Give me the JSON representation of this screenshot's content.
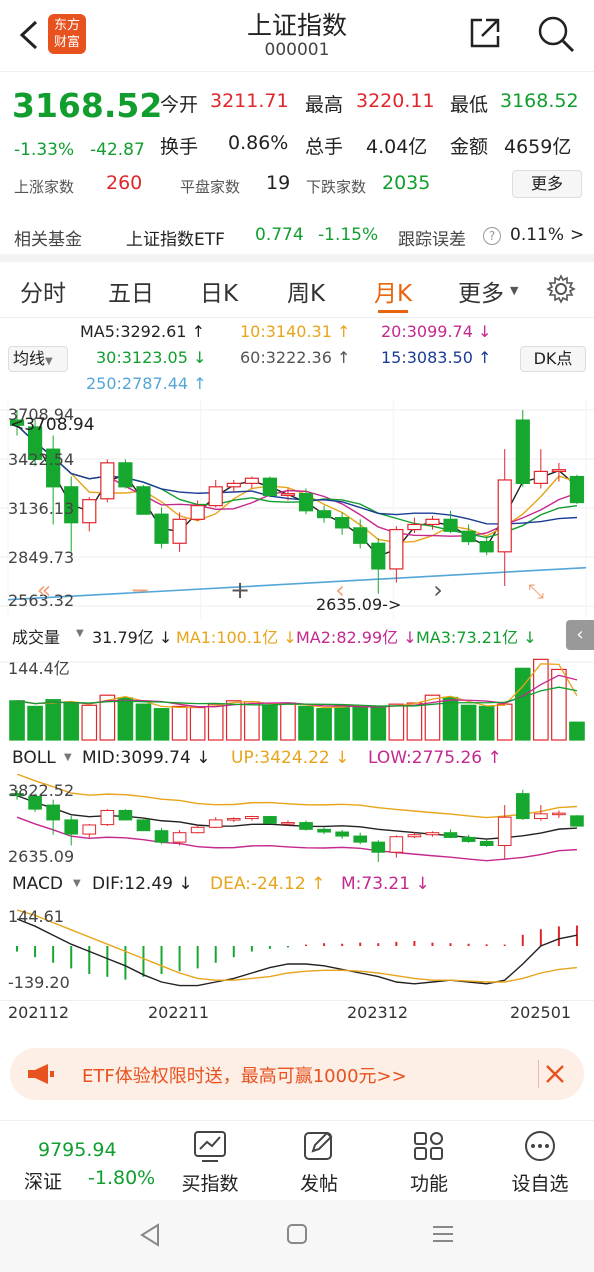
{
  "header": {
    "title": "上证指数",
    "code": "000001",
    "logo_text": "东方财富"
  },
  "quote": {
    "price": "3168.52",
    "change_pct": "-1.33%",
    "change": "-42.87",
    "open_label": "今开",
    "open": "3211.71",
    "high_label": "最高",
    "high": "3220.11",
    "low_label": "最低",
    "low": "3168.52",
    "turnover_label": "换手",
    "turnover": "0.86%",
    "volume_label": "总手",
    "volume": "4.04亿",
    "amount_label": "金额",
    "amount": "4659亿",
    "up_label": "上涨家数",
    "up_count": "260",
    "flat_label": "平盘家数",
    "flat_count": "19",
    "down_label": "下跌家数",
    "down_count": "2035",
    "more_label": "更多"
  },
  "fund": {
    "label": "相关基金",
    "name": "上证指数ETF",
    "price": "0.774",
    "change": "-1.15%",
    "tracking_label": "跟踪误差",
    "tracking_value": "0.11%",
    "arrow": ">"
  },
  "tabs": [
    "分时",
    "五日",
    "日K",
    "周K",
    "月K",
    "更多"
  ],
  "ma_panel": {
    "selector": "均线",
    "dk": "DK点",
    "ma5": "MA5:3292.61 ↑",
    "ma10": "10:3140.31 ↑",
    "ma20": "20:3099.74 ↓",
    "ma30": "30:3123.05 ↓",
    "ma60": "60:3222.36 ↑",
    "ma15": "15:3083.50 ↑",
    "ma250": "250:2787.44 ↑"
  },
  "chart_data": [
    {
      "type": "candlestick",
      "title": "月K",
      "y_ticks": [
        "3708.94",
        "3422.54",
        "3136.13",
        "2849.73",
        "2563.32"
      ],
      "ylim": [
        2563.32,
        3708.94
      ],
      "max_label": "3708.94",
      "min_label": "2635.09->",
      "x_labels": [
        "202112",
        "202211",
        "202312",
        "202501"
      ],
      "candles": [
        {
          "o": 3650,
          "h": 3708,
          "l": 3560,
          "c": 3620
        },
        {
          "o": 3610,
          "h": 3650,
          "l": 3380,
          "c": 3420
        },
        {
          "o": 3480,
          "h": 3560,
          "l": 3040,
          "c": 3260
        },
        {
          "o": 3260,
          "h": 3320,
          "l": 2880,
          "c": 3050
        },
        {
          "o": 3050,
          "h": 3200,
          "l": 3000,
          "c": 3185
        },
        {
          "o": 3190,
          "h": 3420,
          "l": 3170,
          "c": 3400
        },
        {
          "o": 3400,
          "h": 3420,
          "l": 3250,
          "c": 3260
        },
        {
          "o": 3260,
          "h": 3270,
          "l": 3100,
          "c": 3100
        },
        {
          "o": 3100,
          "h": 3140,
          "l": 2900,
          "c": 2930
        },
        {
          "o": 2930,
          "h": 3110,
          "l": 2880,
          "c": 3070
        },
        {
          "o": 3070,
          "h": 3180,
          "l": 3060,
          "c": 3150
        },
        {
          "o": 3150,
          "h": 3300,
          "l": 3140,
          "c": 3260
        },
        {
          "o": 3260,
          "h": 3300,
          "l": 3230,
          "c": 3280
        },
        {
          "o": 3280,
          "h": 3320,
          "l": 3250,
          "c": 3310
        },
        {
          "o": 3310,
          "h": 3320,
          "l": 3200,
          "c": 3210
        },
        {
          "o": 3210,
          "h": 3250,
          "l": 3180,
          "c": 3220
        },
        {
          "o": 3220,
          "h": 3250,
          "l": 3100,
          "c": 3120
        },
        {
          "o": 3120,
          "h": 3150,
          "l": 3050,
          "c": 3080
        },
        {
          "o": 3080,
          "h": 3110,
          "l": 2980,
          "c": 3020
        },
        {
          "o": 3020,
          "h": 3070,
          "l": 2900,
          "c": 2930
        },
        {
          "o": 2930,
          "h": 2960,
          "l": 2635,
          "c": 2780
        },
        {
          "o": 2780,
          "h": 3030,
          "l": 2700,
          "c": 3010
        },
        {
          "o": 3010,
          "h": 3080,
          "l": 2990,
          "c": 3040
        },
        {
          "o": 3040,
          "h": 3090,
          "l": 3010,
          "c": 3070
        },
        {
          "o": 3070,
          "h": 3120,
          "l": 2990,
          "c": 3000
        },
        {
          "o": 3000,
          "h": 3040,
          "l": 2920,
          "c": 2940
        },
        {
          "o": 2940,
          "h": 2970,
          "l": 2860,
          "c": 2880
        },
        {
          "o": 2880,
          "h": 3480,
          "l": 2680,
          "c": 3300
        },
        {
          "o": 3650,
          "h": 3708,
          "l": 3260,
          "c": 3280
        },
        {
          "o": 3280,
          "h": 3480,
          "l": 3250,
          "c": 3350
        },
        {
          "o": 3350,
          "h": 3400,
          "l": 3290,
          "c": 3360
        },
        {
          "o": 3320,
          "h": 3330,
          "l": 3160,
          "c": 3168
        }
      ],
      "ma250_start": 2600,
      "ma250_end": 2787.44
    },
    {
      "type": "bar",
      "title": "成交量",
      "y_tick": "144.4亿",
      "legend": [
        "成交量",
        "31.79亿 ↓",
        "MA1:100.1亿 ↓",
        "MA2:82.99亿 ↓",
        "MA3:73.21亿 ↓"
      ],
      "values": [
        70,
        60,
        72,
        66,
        62,
        80,
        75,
        64,
        56,
        60,
        58,
        64,
        70,
        68,
        62,
        66,
        60,
        56,
        62,
        60,
        58,
        64,
        66,
        80,
        76,
        62,
        60,
        64,
        128,
        144,
        126,
        31.79
      ]
    },
    {
      "type": "line",
      "title": "BOLL",
      "legend": [
        "BOLL",
        "MID:3099.74 ↓",
        "UP:3424.22 ↓",
        "LOW:2775.26 ↑"
      ],
      "y_ticks": [
        "3822.52",
        "2635.09"
      ]
    },
    {
      "type": "bar",
      "title": "MACD",
      "legend": [
        "MACD",
        "DIF:12.49 ↓",
        "DEA:-24.12 ↑",
        "M:73.21 ↓"
      ],
      "y_ticks": [
        "144.61",
        "-139.20"
      ],
      "values": [
        -20,
        -40,
        -60,
        -80,
        -100,
        -110,
        -120,
        -110,
        -100,
        -90,
        -80,
        -60,
        -40,
        -20,
        -10,
        -5,
        5,
        10,
        8,
        12,
        10,
        15,
        18,
        12,
        10,
        8,
        6,
        5,
        40,
        60,
        70,
        73
      ]
    }
  ],
  "banner": {
    "text": "ETF体验权限时送，最高可赢1000元>>"
  },
  "bottom": {
    "index_value": "9795.94",
    "index_name": "深证",
    "index_change": "-1.80%",
    "buy": "买指数",
    "post": "发帖",
    "func": "功能",
    "watch": "设自选"
  }
}
